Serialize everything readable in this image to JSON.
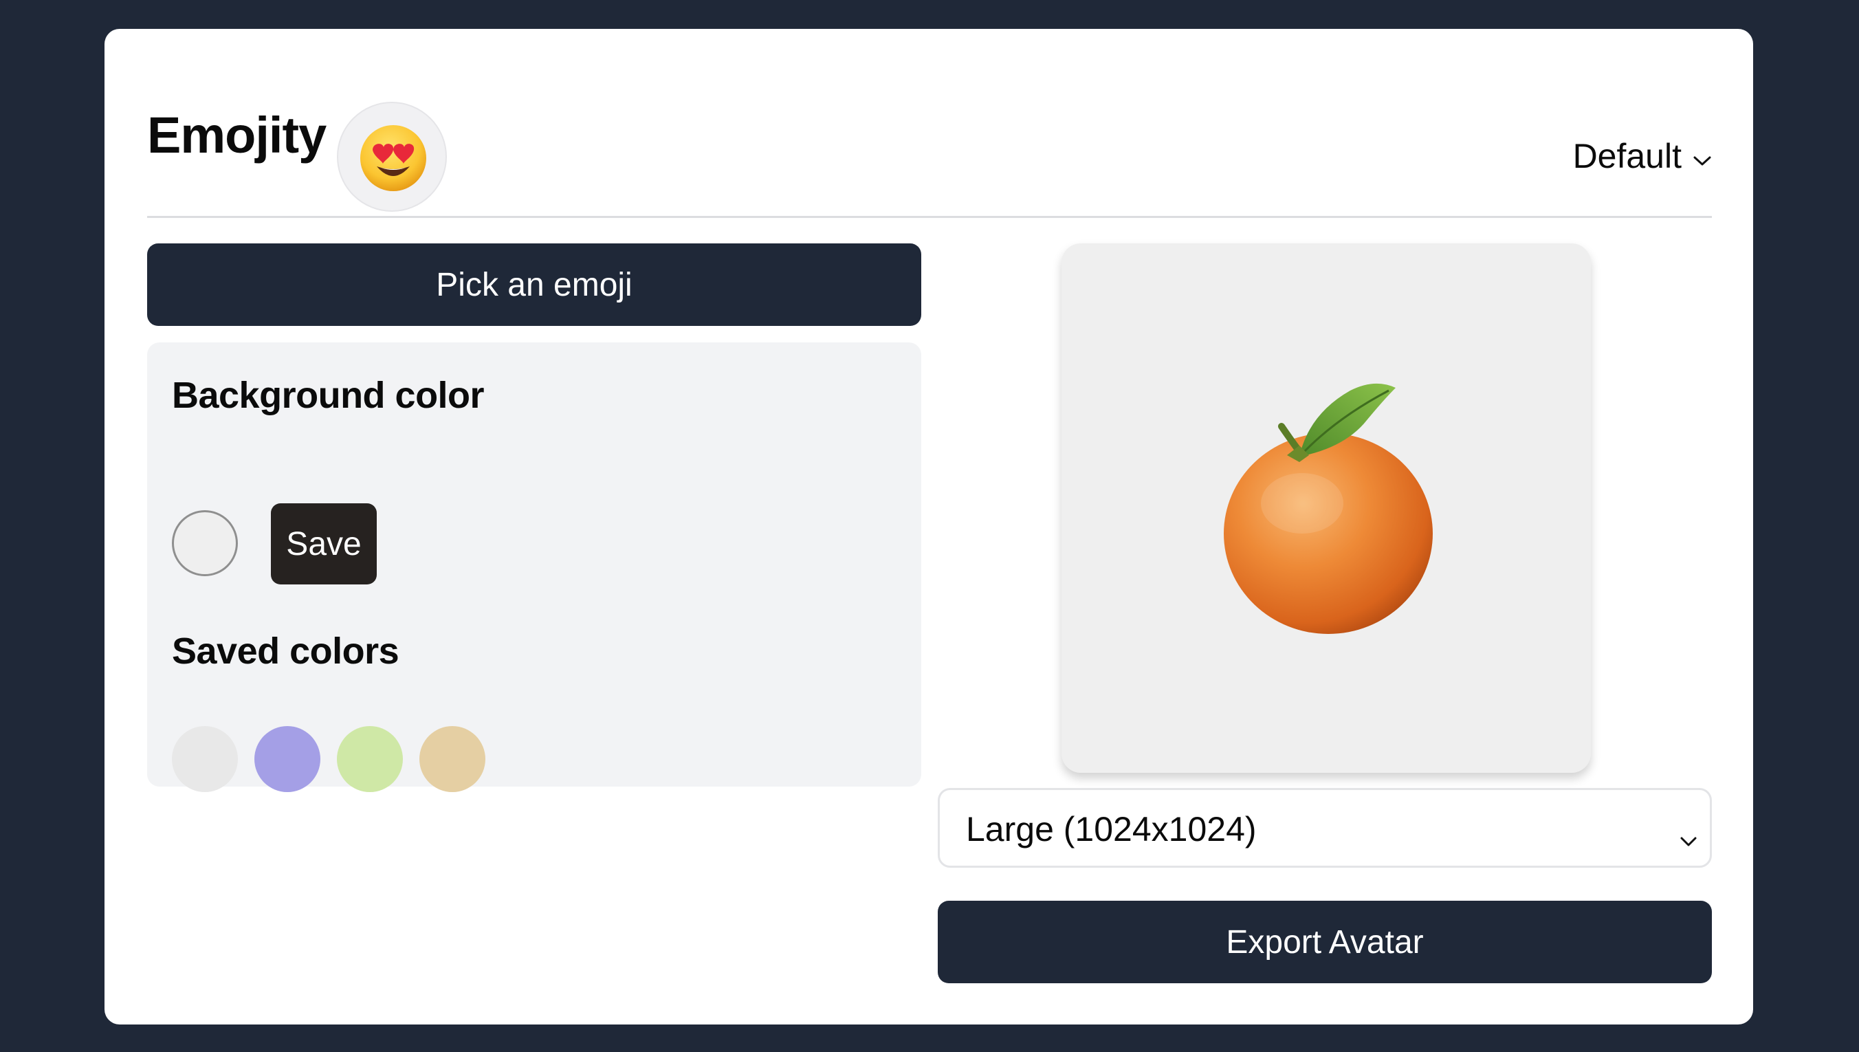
{
  "app": {
    "title": "Emojity",
    "title_icon": "heart-eyes-emoji-icon"
  },
  "header": {
    "preset_label": "Default",
    "preset_icon": "chevron-down-icon"
  },
  "actions": {
    "pick_emoji_label": "Pick an emoji",
    "export_label": "Export Avatar"
  },
  "background": {
    "heading": "Background color",
    "current_color": "#efefef",
    "save_label": "Save"
  },
  "saved": {
    "heading": "Saved colors",
    "colors": [
      "#e8e8e8",
      "#a49fe6",
      "#cfe8a6",
      "#e5cfa3"
    ]
  },
  "preview": {
    "emoji_icon": "tangerine-emoji-icon",
    "background": "#efefef"
  },
  "size": {
    "selected": "Large (1024x1024)",
    "icon": "chevron-down-icon"
  },
  "colors": {
    "page_bg": "#1f2838",
    "primary_button": "#1f2838",
    "save_button": "#262220",
    "panel_bg": "#f2f3f5"
  }
}
